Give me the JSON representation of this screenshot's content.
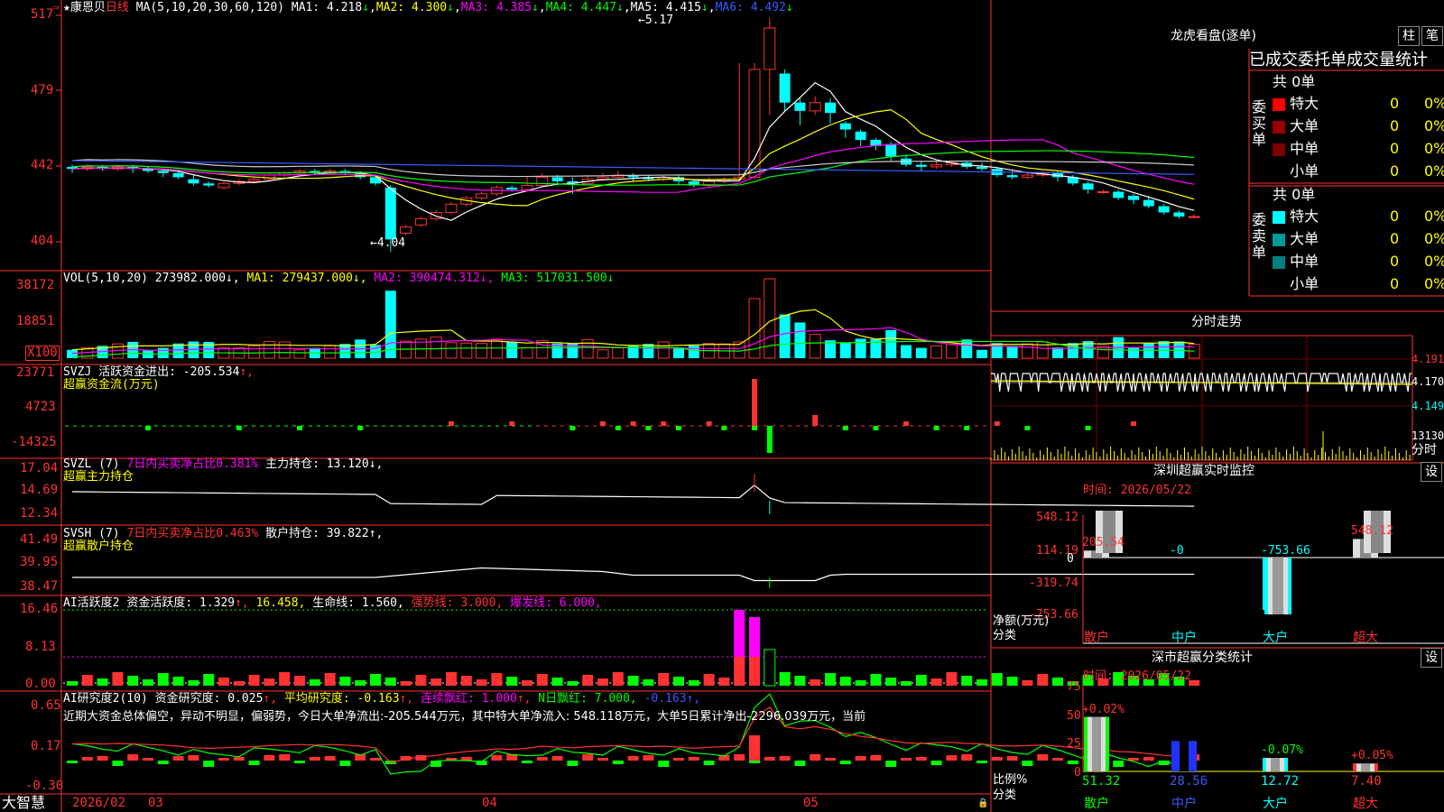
{
  "main_chart": {
    "title_prefix": "★",
    "stock_name": "康恩贝",
    "period": "日线",
    "ma_label": "MA(5,10,20,30,60,120)",
    "ma1_label": "MA1:",
    "ma1_value": "4.218",
    "ma1_arrow": "↓",
    "ma2_label": "MA2:",
    "ma2_value": "4.300",
    "ma2_arrow": "↓",
    "ma3_label": "MA3:",
    "ma3_value": "4.385",
    "ma3_arrow": "↓",
    "ma4_label": "MA4:",
    "ma4_value": "4.447",
    "ma4_arrow": "↓",
    "ma5_label": "MA5:",
    "ma5_value": "4.415",
    "ma5_arrow": "↓",
    "ma6_label": "MA6:",
    "ma6_value": "4.492",
    "ma6_arrow": "↓",
    "y_ticks": [
      "517",
      "479",
      "442",
      "404"
    ],
    "high_label": "5.17",
    "low_label": "4.04",
    "colors": {
      "ma1": "#ffffff",
      "ma2": "#ffff00",
      "ma3": "#ff00ff",
      "ma4": "#00ff00",
      "ma5": "#cccccc",
      "ma6": "#3b5bff"
    }
  },
  "vol_panel": {
    "label": "VOL(5,10,20)",
    "vol": "273982.000↓,",
    "ma1": "MA1: 279437.000↓,",
    "ma2": "MA2: 390474.312↓,",
    "ma3": "MA3: 517031.500↓",
    "y_ticks": [
      "38172",
      "18851"
    ],
    "unit": "X100"
  },
  "svzj_panel": {
    "label": "SVZJ",
    "line1": "活跃资金进出: -205.534",
    "arrow1": "↑,",
    "line2": "超赢资金流(万元)",
    "y_ticks": [
      "23771",
      "4723",
      "-14325"
    ]
  },
  "svzl_panel": {
    "label": "SVZL (7)",
    "ratio": "7日内买卖净占比0.381%",
    "hold": "主力持仓: 13.120↓,",
    "line2": "超赢主力持仓",
    "y_ticks": [
      "17.04",
      "14.69",
      "12.34"
    ]
  },
  "svsh_panel": {
    "label": "SVSH (7)",
    "ratio": "7日内买卖净占比0.463%",
    "hold": "散户持仓: 39.822↑,",
    "line2": "超赢散户持仓",
    "y_ticks": [
      "41.49",
      "39.95",
      "38.47"
    ]
  },
  "ai_active": {
    "label": "AI活跃度2",
    "item1": "资金活跃度: 1.329",
    "a1": "↑,",
    "item2": "16.458,",
    "item3": "生命线: 1.560,",
    "item4": "强势线: 3.000,",
    "item5": "爆发线: 6.000,",
    "y_ticks": [
      "16.46",
      "8.13",
      "0.00"
    ]
  },
  "ai_research": {
    "label": "AI研究度2(10)",
    "item1": "资金研究度: 0.025",
    "a1": "↑,",
    "item2": "平均研究度: -0.163",
    "a2": "↑,",
    "item3": "连续飘红: 1.000",
    "a3": "↑,",
    "item4": "N日飘红: 7.000,",
    "item5": "-0.163↑,",
    "comment": "近期大资金总体偏空，异动不明显，偏弱势，今日大单净流出:-205.544万元，其中特大单净流入: 548.118万元，大单5日累计净出-2296.039万元，当前",
    "y_ticks": [
      "0.65",
      "0.17",
      "-0.30"
    ]
  },
  "bottom_axis": {
    "brand": "大智慧",
    "labels": [
      "2026/02",
      "03",
      "04",
      "05"
    ]
  },
  "right_panel": {
    "lhb_title": "龙虎看盘(逐单)",
    "btn1": "柱",
    "btn2": "笔",
    "subtitle": "已成交委托单成交量统计",
    "buy_side": {
      "label": "委买单",
      "total": "共 0单",
      "rows": [
        {
          "name": "特大",
          "count": "0",
          "pct": "0%",
          "color": "#ff0000"
        },
        {
          "name": "大单",
          "count": "0",
          "pct": "0%",
          "color": "#990000"
        },
        {
          "name": "中单",
          "count": "0",
          "pct": "0%",
          "color": "#800000"
        },
        {
          "name": "小单",
          "count": "0",
          "pct": "0%",
          "color": "#000000"
        }
      ]
    },
    "sell_side": {
      "label": "委卖单",
      "total": "共 0单",
      "rows": [
        {
          "name": "特大",
          "count": "0",
          "pct": "0%",
          "color": "#00ffff"
        },
        {
          "name": "大单",
          "count": "0",
          "pct": "0%",
          "color": "#009999"
        },
        {
          "name": "中单",
          "count": "0",
          "pct": "0%",
          "color": "#008080"
        },
        {
          "name": "小单",
          "count": "0",
          "pct": "0%",
          "color": "#000000"
        }
      ]
    },
    "intraday": {
      "title": "分时走势",
      "y_ticks": [
        "4.191",
        "4.170",
        "4.149"
      ],
      "vol_label": "13130",
      "vol_unit": "分时"
    },
    "monitor": {
      "title": "深圳超赢实时监控",
      "btn": "设",
      "time": "时间: 2026/05/22",
      "y_ticks": [
        "548.12",
        "114.19",
        "0",
        "-319.74",
        "-753.66"
      ],
      "ylabel1": "净额(万元)",
      "ylabel2": "分类",
      "bars": [
        {
          "cat": "散户",
          "value": 205.54,
          "label": "205.54"
        },
        {
          "cat": "中户",
          "value": -0.001,
          "label": "-0"
        },
        {
          "cat": "大户",
          "value": -753.66,
          "label": "-753.66"
        },
        {
          "cat": "超大",
          "value": 548.12,
          "label": "548.12"
        }
      ]
    },
    "classify": {
      "title": "深市超赢分类统计",
      "btn": "设",
      "time": "时间: 2026/05/22",
      "y_ticks": [
        "75",
        "50",
        "25",
        "0"
      ],
      "ylabel1": "比例%",
      "ylabel2": "分类",
      "bars": [
        {
          "cat": "散户",
          "value": 51.32,
          "delta": "+0.02%"
        },
        {
          "cat": "中户",
          "value": 28.56,
          "delta": ""
        },
        {
          "cat": "大户",
          "value": 12.72,
          "delta": "-0.07%"
        },
        {
          "cat": "超大",
          "value": 7.4,
          "delta": "+0.05%"
        }
      ]
    }
  },
  "chart_data": {
    "type": "bar",
    "candles": [
      [
        4.45,
        4.44,
        4.42,
        4.46
      ],
      [
        4.44,
        4.45,
        4.43,
        4.46
      ],
      [
        4.45,
        4.44,
        4.43,
        4.46
      ],
      [
        4.44,
        4.45,
        4.43,
        4.46
      ],
      [
        4.45,
        4.44,
        4.42,
        4.46
      ],
      [
        4.44,
        4.43,
        4.42,
        4.45
      ],
      [
        4.43,
        4.42,
        4.4,
        4.44
      ],
      [
        4.42,
        4.4,
        4.39,
        4.43
      ],
      [
        4.39,
        4.37,
        4.36,
        4.41
      ],
      [
        4.37,
        4.36,
        4.35,
        4.38
      ],
      [
        4.35,
        4.37,
        4.34,
        4.38
      ],
      [
        4.37,
        4.38,
        4.36,
        4.39
      ],
      [
        4.38,
        4.39,
        4.37,
        4.4
      ],
      [
        4.39,
        4.41,
        4.38,
        4.42
      ],
      [
        4.41,
        4.42,
        4.4,
        4.43
      ],
      [
        4.42,
        4.43,
        4.41,
        4.44
      ],
      [
        4.43,
        4.42,
        4.41,
        4.44
      ],
      [
        4.42,
        4.43,
        4.41,
        4.44
      ],
      [
        4.43,
        4.42,
        4.41,
        4.44
      ],
      [
        4.42,
        4.4,
        4.39,
        4.43
      ],
      [
        4.4,
        4.37,
        4.36,
        4.41
      ],
      [
        4.35,
        4.1,
        4.04,
        4.36
      ],
      [
        4.13,
        4.16,
        4.12,
        4.17
      ],
      [
        4.17,
        4.2,
        4.16,
        4.21
      ],
      [
        4.2,
        4.23,
        4.19,
        4.24
      ],
      [
        4.23,
        4.27,
        4.22,
        4.28
      ],
      [
        4.27,
        4.3,
        4.26,
        4.31
      ],
      [
        4.3,
        4.32,
        4.29,
        4.33
      ],
      [
        4.32,
        4.35,
        4.31,
        4.36
      ],
      [
        4.35,
        4.34,
        4.33,
        4.36
      ],
      [
        4.34,
        4.36,
        4.33,
        4.4
      ],
      [
        4.36,
        4.4,
        4.35,
        4.42
      ],
      [
        4.4,
        4.38,
        4.36,
        4.41
      ],
      [
        4.38,
        4.37,
        4.32,
        4.4
      ],
      [
        4.37,
        4.39,
        4.36,
        4.41
      ],
      [
        4.39,
        4.4,
        4.38,
        4.42
      ],
      [
        4.4,
        4.41,
        4.39,
        4.43
      ],
      [
        4.41,
        4.4,
        4.38,
        4.42
      ],
      [
        4.4,
        4.39,
        4.38,
        4.41
      ],
      [
        4.39,
        4.4,
        4.38,
        4.41
      ],
      [
        4.4,
        4.38,
        4.36,
        4.41
      ],
      [
        4.38,
        4.36,
        4.35,
        4.39
      ],
      [
        4.36,
        4.38,
        4.35,
        4.4
      ],
      [
        4.38,
        4.39,
        4.37,
        4.4
      ],
      [
        4.39,
        4.4,
        4.38,
        4.95
      ],
      [
        4.4,
        4.92,
        4.39,
        4.95
      ],
      [
        4.92,
        5.12,
        4.7,
        5.17
      ],
      [
        4.9,
        4.76,
        4.72,
        4.92
      ],
      [
        4.76,
        4.72,
        4.65,
        4.78
      ],
      [
        4.72,
        4.76,
        4.7,
        4.79
      ],
      [
        4.76,
        4.71,
        4.66,
        4.78
      ],
      [
        4.66,
        4.63,
        4.59,
        4.67
      ],
      [
        4.62,
        4.58,
        4.55,
        4.63
      ],
      [
        4.58,
        4.55,
        4.53,
        4.59
      ],
      [
        4.56,
        4.5,
        4.48,
        4.57
      ],
      [
        4.49,
        4.46,
        4.45,
        4.51
      ],
      [
        4.46,
        4.45,
        4.43,
        4.48
      ],
      [
        4.45,
        4.46,
        4.44,
        4.48
      ],
      [
        4.46,
        4.47,
        4.45,
        4.48
      ],
      [
        4.47,
        4.45,
        4.44,
        4.48
      ],
      [
        4.45,
        4.44,
        4.43,
        4.47
      ],
      [
        4.44,
        4.41,
        4.4,
        4.45
      ],
      [
        4.41,
        4.4,
        4.39,
        4.43
      ],
      [
        4.4,
        4.41,
        4.39,
        4.42
      ],
      [
        4.41,
        4.42,
        4.4,
        4.43
      ],
      [
        4.42,
        4.4,
        4.38,
        4.43
      ],
      [
        4.4,
        4.37,
        4.36,
        4.41
      ],
      [
        4.37,
        4.34,
        4.32,
        4.38
      ],
      [
        4.33,
        4.33,
        4.32,
        4.34
      ],
      [
        4.33,
        4.3,
        4.29,
        4.34
      ],
      [
        4.31,
        4.29,
        4.27,
        4.32
      ],
      [
        4.29,
        4.26,
        4.25,
        4.31
      ],
      [
        4.26,
        4.23,
        4.22,
        4.27
      ],
      [
        4.23,
        4.21,
        4.2,
        4.24
      ],
      [
        4.21,
        4.21,
        4.2,
        4.22
      ]
    ],
    "ylim": [
      4.01,
      5.22
    ]
  }
}
